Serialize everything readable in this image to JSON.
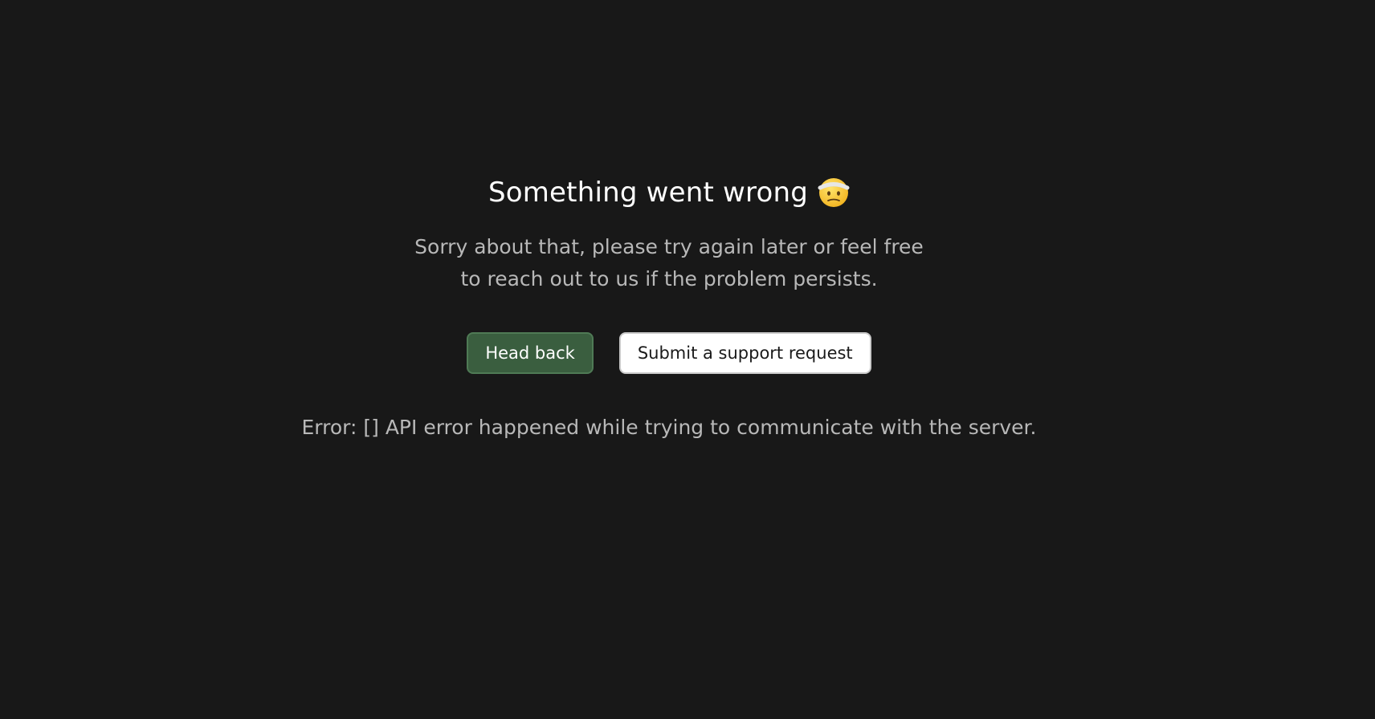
{
  "page": {
    "title": "Something went wrong",
    "title_emoji": "face-with-head-bandage",
    "subtitle_line1": "Sorry about that, please try again later or feel free",
    "subtitle_line2": "to reach out to us if the problem persists.",
    "error_message": "Error: [] API error happened while trying to communicate with the server."
  },
  "actions": {
    "head_back_label": "Head back",
    "support_label": "Submit a support request"
  },
  "colors": {
    "background": "#181818",
    "primary_button": "#3a5e3f",
    "secondary_button": "#ffffff",
    "text_primary": "#ffffff",
    "text_secondary": "#b8b8b8"
  }
}
